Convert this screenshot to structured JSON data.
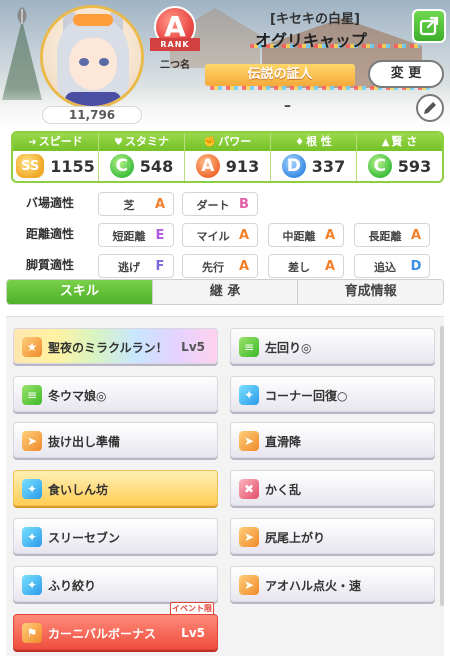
{
  "header": {
    "fans": "11,796",
    "rank": {
      "grade": "A",
      "label": "RANK",
      "nickname": "二つ名"
    },
    "title": "[キセキの白星]",
    "name": "オグリキャップ",
    "honor": "伝説の証人",
    "change_label": "変 更",
    "subtitle": "–"
  },
  "stats": [
    {
      "label": "スピード",
      "icon": "shoe-icon",
      "grade": "SS",
      "value": "1155"
    },
    {
      "label": "スタミナ",
      "icon": "heart-icon",
      "grade": "C",
      "value": "548"
    },
    {
      "label": "パワー",
      "icon": "muscle-icon",
      "grade": "A",
      "value": "913"
    },
    {
      "label": "根 性",
      "icon": "flame-icon",
      "grade": "D",
      "value": "337"
    },
    {
      "label": "賢 さ",
      "icon": "cap-icon",
      "grade": "C",
      "value": "593"
    }
  ],
  "aptitude": {
    "rows": [
      {
        "label": "バ場適性",
        "cells": [
          {
            "name": "芝",
            "grade": "A"
          },
          {
            "name": "ダート",
            "grade": "B"
          }
        ]
      },
      {
        "label": "距離適性",
        "cells": [
          {
            "name": "短距離",
            "grade": "E"
          },
          {
            "name": "マイル",
            "grade": "A"
          },
          {
            "name": "中距離",
            "grade": "A"
          },
          {
            "name": "長距離",
            "grade": "A"
          }
        ]
      },
      {
        "label": "脚質適性",
        "cells": [
          {
            "name": "逃げ",
            "grade": "F"
          },
          {
            "name": "先行",
            "grade": "A"
          },
          {
            "name": "差し",
            "grade": "A"
          },
          {
            "name": "追込",
            "grade": "D"
          }
        ]
      }
    ]
  },
  "tabs": [
    "スキル",
    "継 承",
    "育成情報"
  ],
  "skills": [
    {
      "name": "聖夜のミラクルラン！",
      "level": "Lv5",
      "style": "rainbow",
      "icon": "orange"
    },
    {
      "name": "左回り◎",
      "level": "",
      "style": "normal",
      "icon": "green"
    },
    {
      "name": "冬ウマ娘◎",
      "level": "",
      "style": "normal",
      "icon": "green"
    },
    {
      "name": "コーナー回復○",
      "level": "",
      "style": "normal",
      "icon": "blue"
    },
    {
      "name": "抜け出し準備",
      "level": "",
      "style": "normal",
      "icon": "orange"
    },
    {
      "name": "直滑降",
      "level": "",
      "style": "normal",
      "icon": "orange"
    },
    {
      "name": "食いしん坊",
      "level": "",
      "style": "gold",
      "icon": "blue"
    },
    {
      "name": "かく乱",
      "level": "",
      "style": "normal",
      "icon": "red"
    },
    {
      "name": "スリーセブン",
      "level": "",
      "style": "normal",
      "icon": "blue"
    },
    {
      "name": "尻尾上がり",
      "level": "",
      "style": "normal",
      "icon": "orange"
    },
    {
      "name": "ふり絞り",
      "level": "",
      "style": "normal",
      "icon": "blue"
    },
    {
      "name": "アオハル点火・速",
      "level": "",
      "style": "normal",
      "icon": "orange"
    },
    {
      "name": "カーニバルボーナス",
      "level": "Lv5",
      "style": "red",
      "icon": "orange",
      "tag": "イベント限定"
    }
  ]
}
